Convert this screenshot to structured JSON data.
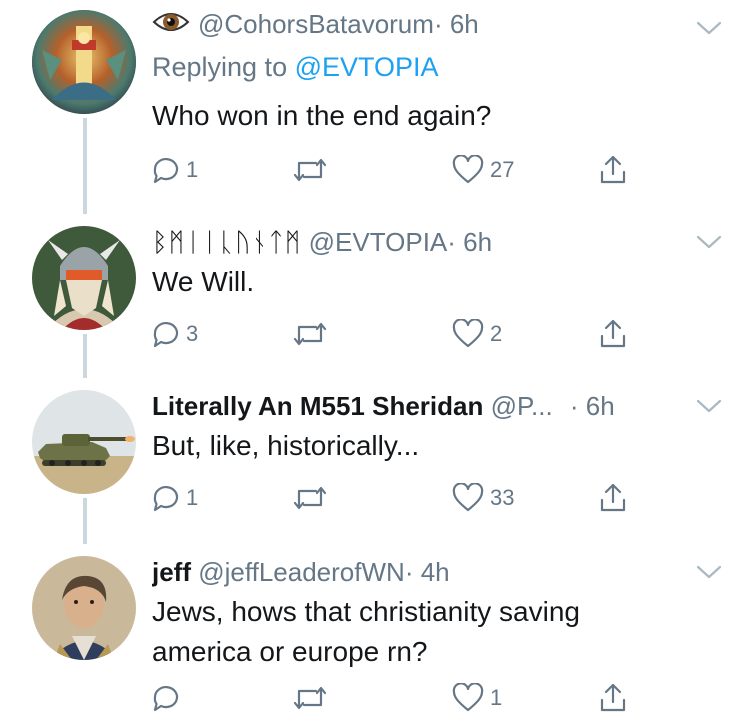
{
  "tweets": [
    {
      "handle": "@CohorsBatavorum",
      "time": "· 6h",
      "replying_prefix": "Replying to",
      "replying_to": "@EVTOPIA",
      "text": "Who won in the end again?",
      "replies": "1",
      "retweets": "",
      "likes": "27",
      "avatar_icon": "ornate-icon-avatar"
    },
    {
      "display_name": "ᛒᛗᛁᛁᚳᚢᚾᛏᛗ",
      "handle": "@EVTOPIA",
      "time": "· 6h",
      "text": "We Will.",
      "replies": "3",
      "retweets": "",
      "likes": "2",
      "avatar_icon": "helmeted-warrior-avatar"
    },
    {
      "display_name": "Literally An M551 Sheridan",
      "handle": "@P...",
      "time": "· 6h",
      "text": "But, like, historically...",
      "replies": "1",
      "retweets": "",
      "likes": "33",
      "avatar_icon": "tank-avatar"
    },
    {
      "display_name": "jeff",
      "handle": "@jeffLeaderofWN",
      "time": "· 4h",
      "text_line1": "Jews, hows that christianity saving",
      "text_line2": "america or europe rn?",
      "replies": "",
      "retweets": "",
      "likes": "1",
      "avatar_icon": "portrait-avatar"
    }
  ],
  "colors": {
    "text": "#14171a",
    "secondary": "#657786",
    "link": "#1da1f2",
    "thread_line": "#ccd6dd"
  }
}
